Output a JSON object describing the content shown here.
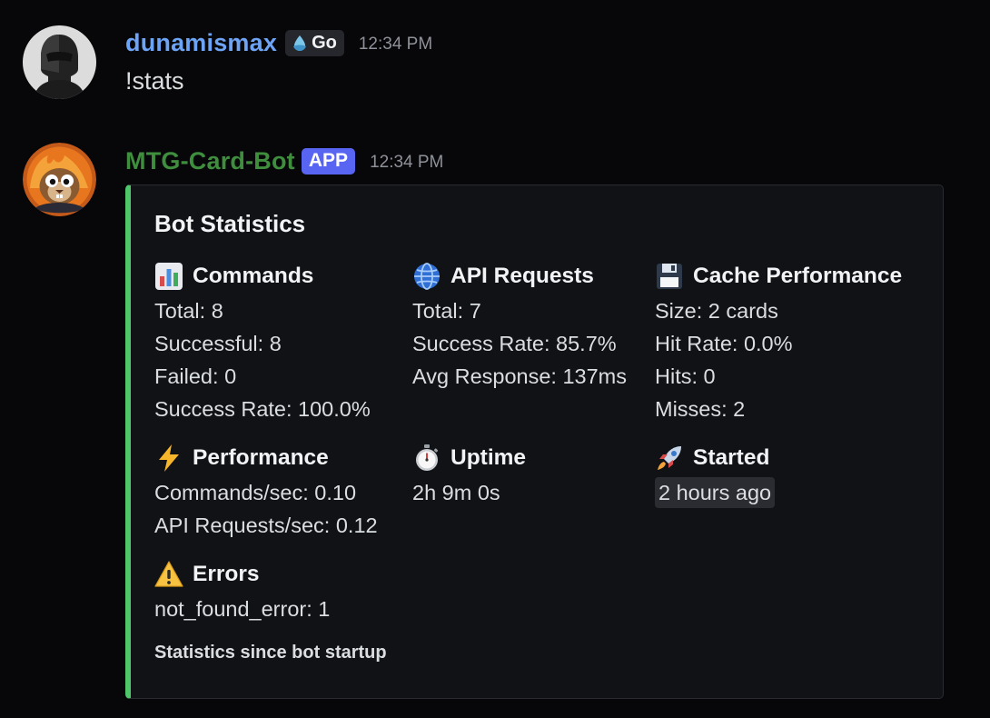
{
  "messages": [
    {
      "username": "dunamismax",
      "guild_tag": "Go",
      "guild_icon": "water-drop-icon",
      "timestamp": "12:34 PM",
      "content": "!stats",
      "colors": {
        "username": "#6ea4f5"
      }
    },
    {
      "username": "MTG-Card-Bot",
      "badge": "APP",
      "timestamp": "12:34 PM",
      "colors": {
        "username": "#3f8e3e",
        "badge": "#5865f2",
        "embed_accent": "#4ec76b"
      },
      "embed": {
        "title": "Bot Statistics",
        "fields": {
          "commands": {
            "icon": "bar-chart-icon",
            "name": "Commands",
            "lines": [
              "Total: 8",
              "Successful: 8",
              "Failed: 0",
              "Success Rate: 100.0%"
            ]
          },
          "api_requests": {
            "icon": "globe-icon",
            "name": "API Requests",
            "lines": [
              "Total: 7",
              "Success Rate: 85.7%",
              "Avg Response: 137ms"
            ]
          },
          "cache": {
            "icon": "floppy-disk-icon",
            "name": "Cache Performance",
            "lines": [
              "Size: 2 cards",
              "Hit Rate: 0.0%",
              "Hits: 0",
              "Misses: 2"
            ]
          },
          "performance": {
            "icon": "lightning-icon",
            "name": "Performance",
            "lines": [
              "Commands/sec: 0.10",
              "API Requests/sec: 0.12"
            ]
          },
          "uptime": {
            "icon": "stopwatch-icon",
            "name": "Uptime",
            "lines": [
              "2h 9m 0s"
            ]
          },
          "started": {
            "icon": "rocket-icon",
            "name": "Started",
            "timestamp_text": "2 hours ago"
          },
          "errors": {
            "icon": "warning-icon",
            "name": "Errors",
            "lines": [
              "not_found_error: 1"
            ]
          }
        },
        "footer": "Statistics since bot startup"
      }
    }
  ]
}
